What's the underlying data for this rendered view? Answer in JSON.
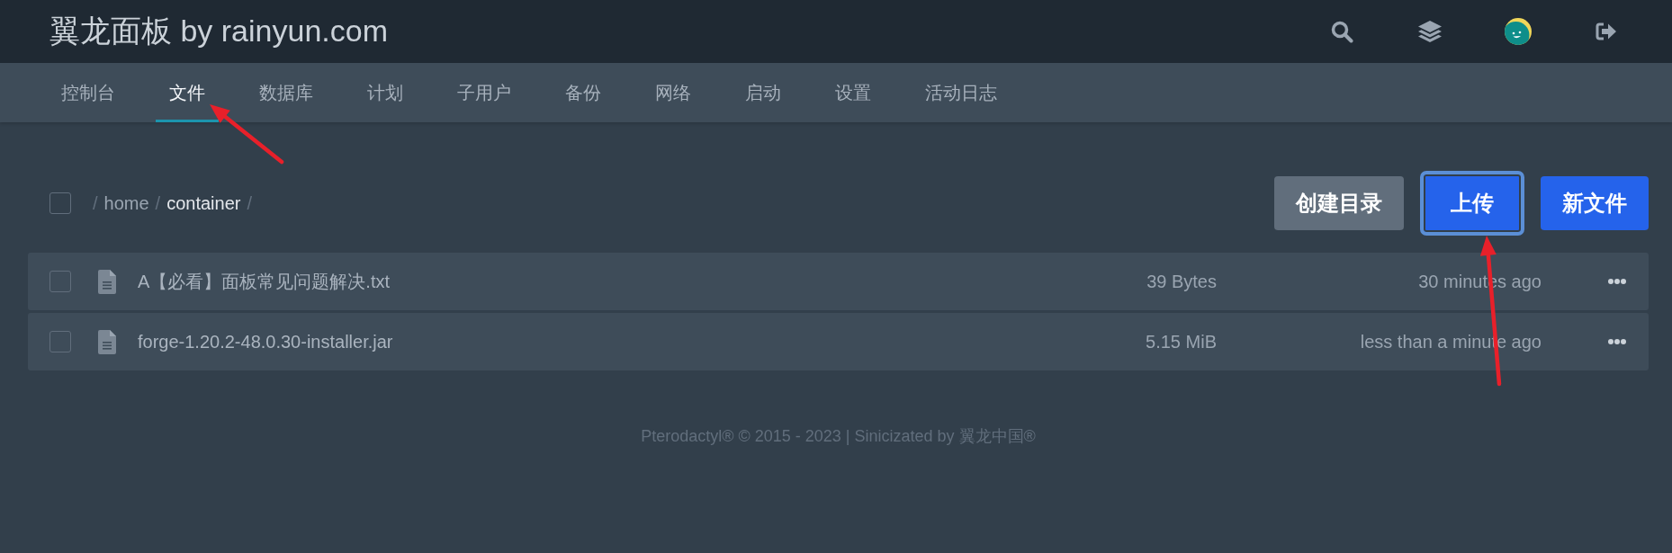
{
  "header": {
    "title": "翼龙面板 by rainyun.com"
  },
  "tabs": [
    {
      "label": "控制台",
      "selected": false
    },
    {
      "label": "文件",
      "selected": true
    },
    {
      "label": "数据库",
      "selected": false
    },
    {
      "label": "计划",
      "selected": false
    },
    {
      "label": "子用户",
      "selected": false
    },
    {
      "label": "备份",
      "selected": false
    },
    {
      "label": "网络",
      "selected": false
    },
    {
      "label": "启动",
      "selected": false
    },
    {
      "label": "设置",
      "selected": false
    },
    {
      "label": "活动日志",
      "selected": false
    }
  ],
  "breadcrumb": {
    "checked": false,
    "items": [
      {
        "kind": "separator",
        "text": "/"
      },
      {
        "kind": "link",
        "text": "home"
      },
      {
        "kind": "separator",
        "text": "/"
      },
      {
        "kind": "current",
        "text": "container"
      },
      {
        "kind": "separator",
        "text": "/"
      }
    ]
  },
  "buttons": [
    {
      "label": "创建目录",
      "kind": "secondary",
      "focused": false
    },
    {
      "label": "上传",
      "kind": "primary",
      "focused": true
    },
    {
      "label": "新文件",
      "kind": "primary",
      "focused": false
    }
  ],
  "files": [
    {
      "checked": false,
      "name": "A【必看】面板常见问题解决.txt",
      "size": "39 Bytes",
      "modified": "30 minutes ago"
    },
    {
      "checked": false,
      "name": "forge-1.20.2-48.0.30-installer.jar",
      "size": "5.15 MiB",
      "modified": "less than a minute ago"
    }
  ],
  "footer": {
    "text": "Pterodactyl® © 2015 - 2023 | Sinicizated by 翼龙中国®"
  }
}
